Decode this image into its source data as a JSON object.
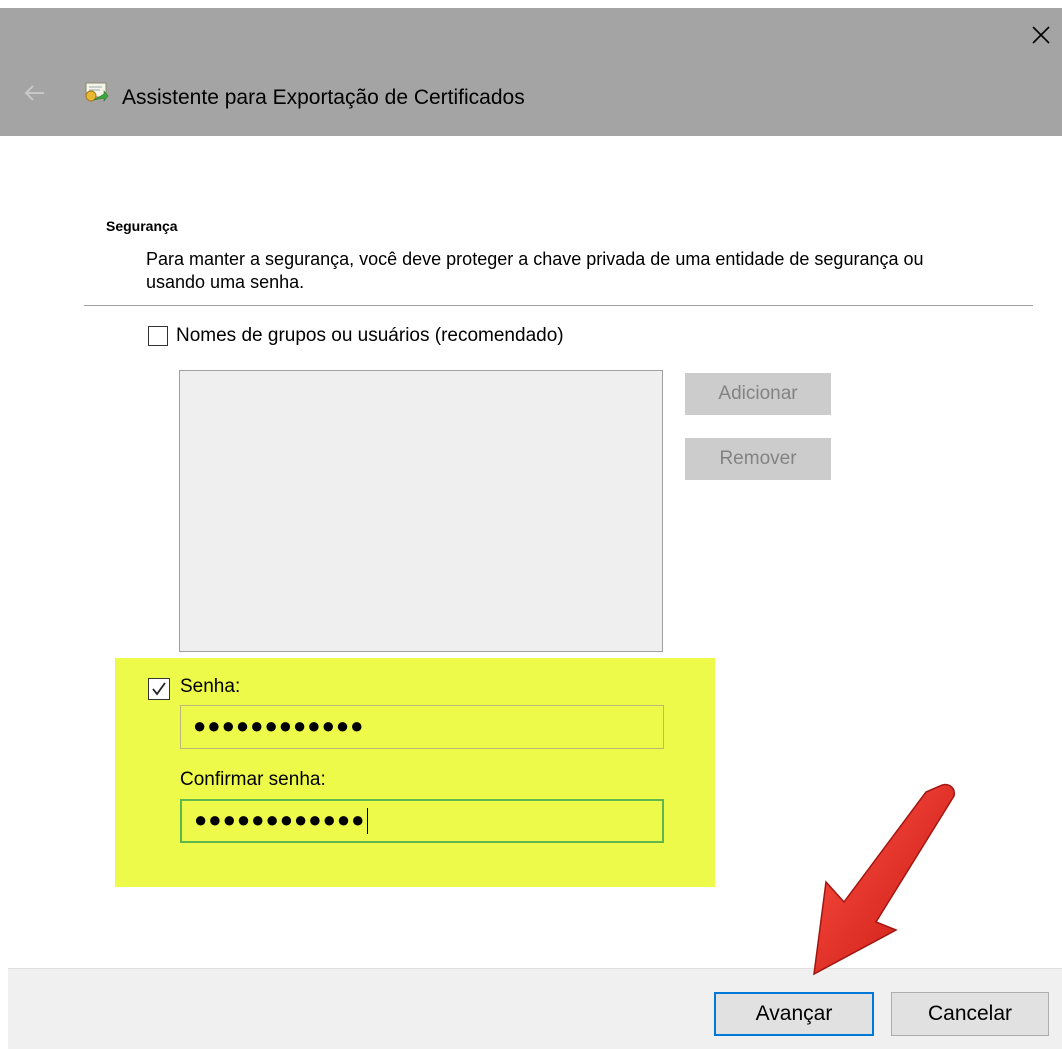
{
  "window": {
    "title": "Assistente para Exportação de Certificados",
    "icons": {
      "close": "close-icon",
      "back": "back-arrow-icon",
      "app": "certificate-icon"
    }
  },
  "section": {
    "heading": "Segurança",
    "description": "Para manter a segurança, você deve proteger a chave privada de uma entidade de segurança ou usando uma senha."
  },
  "groups": {
    "checkbox_label": "Nomes de grupos ou usuários (recomendado)",
    "checked": false,
    "add_label": "Adicionar",
    "remove_label": "Remover"
  },
  "password": {
    "checkbox_label": "Senha:",
    "checked": true,
    "value_masked": "●●●●●●●●●●●●",
    "confirm_label": "Confirmar senha:",
    "confirm_value_masked": "●●●●●●●●●●●●"
  },
  "footer": {
    "next_label": "Avançar",
    "cancel_label": "Cancelar"
  },
  "colors": {
    "titlebar": "#a4a4a4",
    "highlight": "#eefa4a",
    "primary_border": "#0078d7",
    "annotation_arrow": "#e8120c"
  }
}
